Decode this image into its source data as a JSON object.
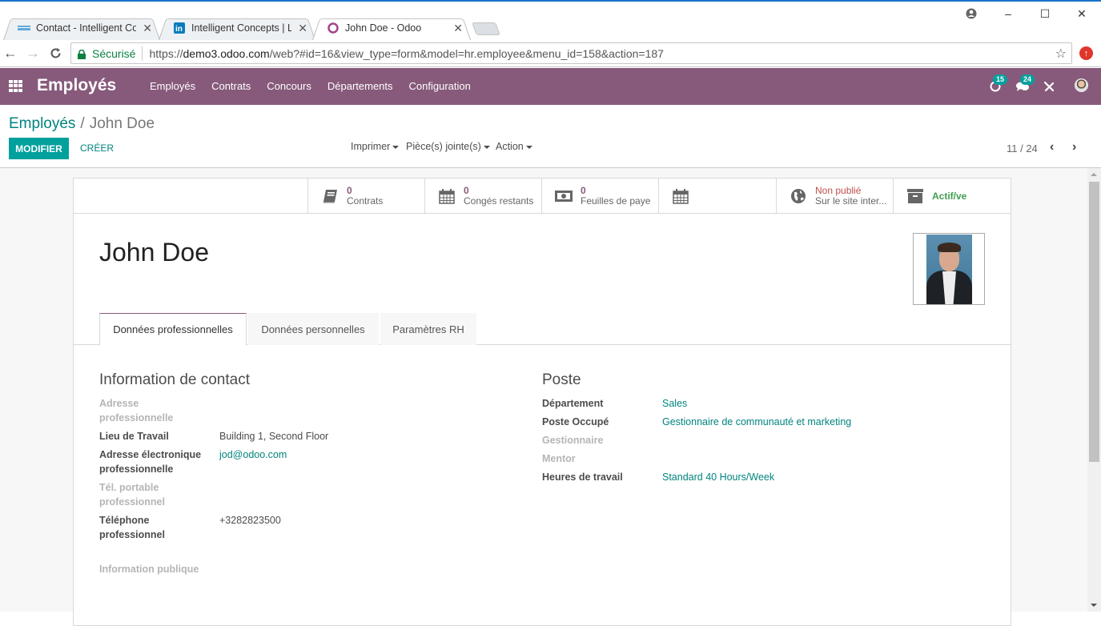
{
  "browser": {
    "tabs": [
      {
        "title": "Contact - Intelligent Con",
        "favicon": "intelligent-concepts-icon",
        "active": false
      },
      {
        "title": "Intelligent Concepts | Lin",
        "favicon": "linkedin-icon",
        "active": false
      },
      {
        "title": "John Doe - Odoo",
        "favicon": "odoo-icon",
        "active": true
      }
    ],
    "secure_label": "Sécurisé",
    "url_prefix": "https://",
    "url_host": "demo3.odoo.com",
    "url_path": "/web?#id=16&view_type=form&model=hr.employee&menu_id=158&action=187",
    "window_controls": {
      "profile": "profile-icon",
      "minimize": "–",
      "maximize": "☐",
      "close": "✕"
    }
  },
  "navbar": {
    "app_name": "Employés",
    "menu": [
      "Employés",
      "Contrats",
      "Concours",
      "Départements",
      "Configuration"
    ],
    "activity_count": "15",
    "message_count": "24",
    "accent": "#875a7b"
  },
  "control_panel": {
    "breadcrumb_parent": "Employés",
    "breadcrumb_sep": "/",
    "breadcrumb_current": "John Doe",
    "edit_label": "MODIFIER",
    "create_label": "CRÉER",
    "dropdowns": [
      "Imprimer",
      "Pièce(s) jointe(s)",
      "Action"
    ],
    "pager": "11 / 24",
    "primary_color": "#00a09d"
  },
  "smart_buttons": [
    {
      "value": "0",
      "label": "Contrats",
      "icon": "book-icon"
    },
    {
      "value": "0",
      "label": "Congés restants",
      "icon": "calendar-icon"
    },
    {
      "value": "0",
      "label": "Feuilles de paye",
      "icon": "money-icon"
    },
    {
      "value": "",
      "label": "",
      "icon": "calendar-icon"
    },
    {
      "value": "Non publié",
      "label": "Sur le site inter...",
      "icon": "globe-icon"
    },
    {
      "value": "",
      "label": "Actif/ve",
      "icon": "archive-icon"
    }
  ],
  "employee": {
    "name": "John Doe"
  },
  "notebook": {
    "tabs": [
      "Données professionnelles",
      "Données personnelles",
      "Paramètres RH"
    ]
  },
  "contact_group": {
    "title": "Information de contact",
    "fields": [
      {
        "label": "Adresse professionnelle",
        "value": "",
        "empty": true
      },
      {
        "label": "Lieu de Travail",
        "value": "Building 1, Second Floor"
      },
      {
        "label": "Adresse électronique professionnelle",
        "value": "jod@odoo.com",
        "link": true
      },
      {
        "label": "Tél. portable professionnel",
        "value": "",
        "empty": true
      },
      {
        "label": "Téléphone professionnel",
        "value": "+3282823500"
      }
    ],
    "public_info_label": "Information publique"
  },
  "position_group": {
    "title": "Poste",
    "fields": [
      {
        "label": "Département",
        "value": "Sales",
        "link": true
      },
      {
        "label": "Poste Occupé",
        "value": "Gestionnaire de communauté et marketing",
        "link": true
      },
      {
        "label": "Gestionnaire",
        "value": "",
        "empty": true
      },
      {
        "label": "Mentor",
        "value": "",
        "empty": true
      },
      {
        "label": "Heures de travail",
        "value": "Standard 40 Hours/Week",
        "link": true
      }
    ]
  }
}
